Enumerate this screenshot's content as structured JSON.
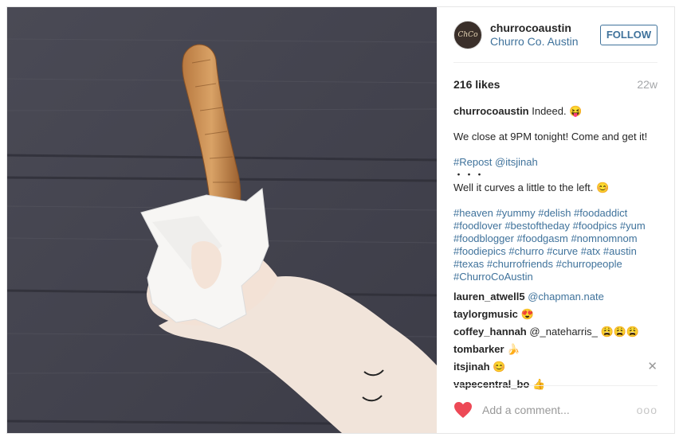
{
  "post": {
    "username": "churrocoaustin",
    "full_name": "Churro Co. Austin",
    "avatar_text": "ChCo",
    "follow_label": "FOLLOW",
    "likes": "216 likes",
    "age": "22w"
  },
  "caption": {
    "user": "churrocoaustin",
    "line1": " Indeed. 😝",
    "line2": "We close at 9PM tonight! Come and get it!",
    "repost": "#Repost @itsjinah",
    "dots": "・・・",
    "line3": "Well it curves a little to the left. 😊",
    "hashtags": [
      "#heaven #yummy #delish #foodaddict",
      "#foodlover #bestoftheday #foodpics #yum",
      "#foodblogger #foodgasm #nomnomnom",
      "#foodiepics #churro #curve #atx #austin",
      "#texas #churrofriends #churropeople",
      "#ChurroCoAustin"
    ]
  },
  "comments": [
    {
      "user": "lauren_atwell5",
      "text": " @chapman.nate"
    },
    {
      "user": "taylorgmusic",
      "text": " 😍"
    },
    {
      "user": "coffey_hannah",
      "text": " @_nateharris_ 😩😩😩"
    },
    {
      "user": "tombarker",
      "text": " 🍌"
    },
    {
      "user": "itsjinah",
      "text": " 😊"
    },
    {
      "user": "vapecentral_bo",
      "text": " 👍"
    }
  ],
  "footer": {
    "placeholder": "Add a comment...",
    "more": "ooo"
  },
  "icons": {
    "heart": "heart-icon",
    "close": "close-icon",
    "more": "more-options-icon"
  },
  "colors": {
    "link": "#3f729b",
    "heart": "#ed4956",
    "text": "#262626",
    "muted": "#a5a7aa"
  }
}
